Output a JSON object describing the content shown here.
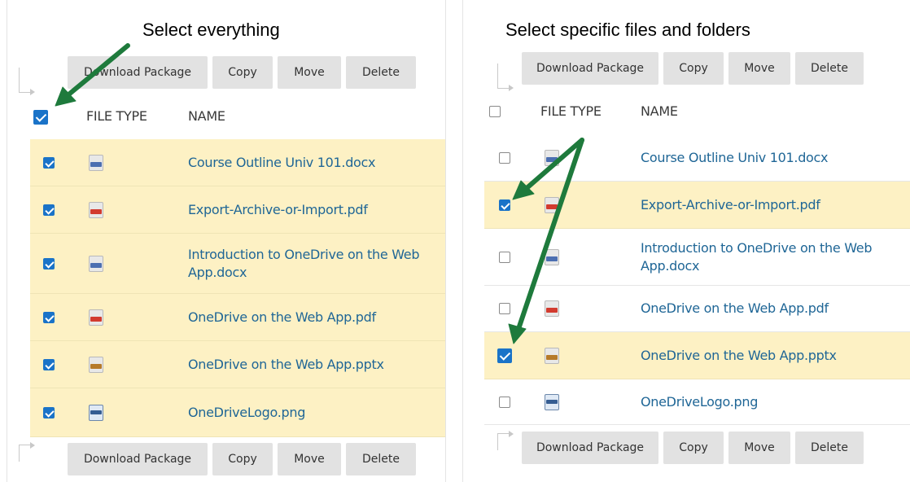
{
  "left": {
    "caption": "Select everything",
    "toolbar": {
      "download_label": "Download Package",
      "copy_label": "Copy",
      "move_label": "Move",
      "delete_label": "Delete"
    },
    "header": {
      "file_type": "FILE TYPE",
      "name": "NAME",
      "select_all_checked": true
    },
    "rows": [
      {
        "name": "Course Outline Univ 101.docx",
        "type_icon": "docx-file-icon",
        "checked": true
      },
      {
        "name": "Export-Archive-or-Import.pdf",
        "type_icon": "pdf-file-icon",
        "checked": true
      },
      {
        "name_line1": "Introduction to OneDrive on the Web",
        "name_line2": "App.docx",
        "type_icon": "docx-file-icon",
        "checked": true
      },
      {
        "name": "OneDrive on the Web App.pdf",
        "type_icon": "pdf-file-icon",
        "checked": true
      },
      {
        "name": "OneDrive on the Web App.pptx",
        "type_icon": "pptx-file-icon",
        "checked": true
      },
      {
        "name": "OneDriveLogo.png",
        "type_icon": "png-image-icon",
        "checked": true
      }
    ]
  },
  "right": {
    "caption": "Select specific files and folders",
    "toolbar": {
      "download_label": "Download Package",
      "copy_label": "Copy",
      "move_label": "Move",
      "delete_label": "Delete"
    },
    "header": {
      "file_type": "FILE TYPE",
      "name": "NAME",
      "select_all_checked": false
    },
    "rows": [
      {
        "name": "Course Outline Univ 101.docx",
        "type_icon": "docx-file-icon",
        "checked": false
      },
      {
        "name": "Export-Archive-or-Import.pdf",
        "type_icon": "pdf-file-icon",
        "checked": true
      },
      {
        "name_line1": "Introduction to OneDrive on the Web",
        "name_line2": "App.docx",
        "type_icon": "docx-file-icon",
        "checked": false
      },
      {
        "name": "OneDrive on the Web App.pdf",
        "type_icon": "pdf-file-icon",
        "checked": false
      },
      {
        "name": "OneDrive on the Web App.pptx",
        "type_icon": "pptx-file-icon",
        "checked": true
      },
      {
        "name": "OneDriveLogo.png",
        "type_icon": "png-image-icon",
        "checked": false
      }
    ]
  },
  "colors": {
    "selected_row": "#fdf1c4",
    "link_text": "#1f6696",
    "checkbox_checked": "#1a73c8",
    "annotation_arrow": "#1e7a3c",
    "button_bg": "#e2e2e2"
  }
}
